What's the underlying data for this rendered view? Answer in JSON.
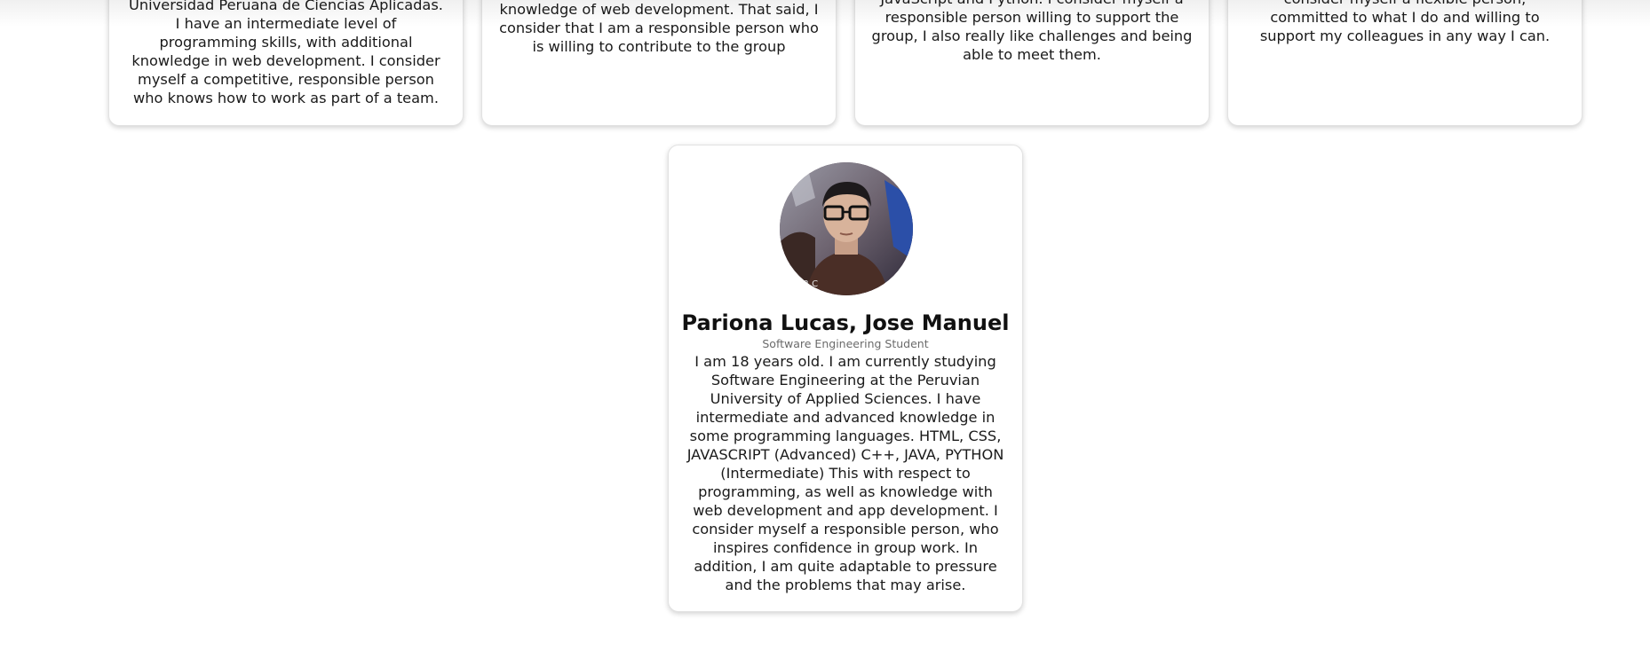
{
  "cards_top": [
    {
      "text": "Universidad Peruana de Ciencias Aplicadas. I have an intermediate level of programming skills, with additional knowledge in web development. I consider myself a competitive, responsible person who knows how to work as part of a team."
    },
    {
      "text": "knowledge of web development. That said, I consider that I am a responsible person who is willing to contribute to the group"
    },
    {
      "text": "JavaScript and Python. I consider myself a responsible person willing to support the group, I also really like challenges and being able to meet them."
    },
    {
      "text": "consider myself a flexible person, committed to what I do and willing to support my colleagues in any way I can."
    }
  ],
  "profile": {
    "name": "Pariona Lucas, Jose Manuel",
    "role": "Software Engineering Student",
    "bio": "I am 18 years old. I am currently studying Software Engineering at the Peruvian University of Applied Sciences. I have intermediate and advanced knowledge in some programming languages. HTML, CSS, JAVASCRIPT (Advanced) C++, JAVA, PYTHON (Intermediate) This with respect to programming, as well as knowledge with web development and app development. I consider myself a responsible person, who inspires confidence in group work. In addition, I am quite adaptable to pressure and the problems that may arise.",
    "avatar_icon": "profile-photo"
  },
  "colors": {
    "background": "#ffffff",
    "card_border": "#e2e2e2",
    "text": "#1a1a1a",
    "role_text": "#6b6b6b"
  }
}
